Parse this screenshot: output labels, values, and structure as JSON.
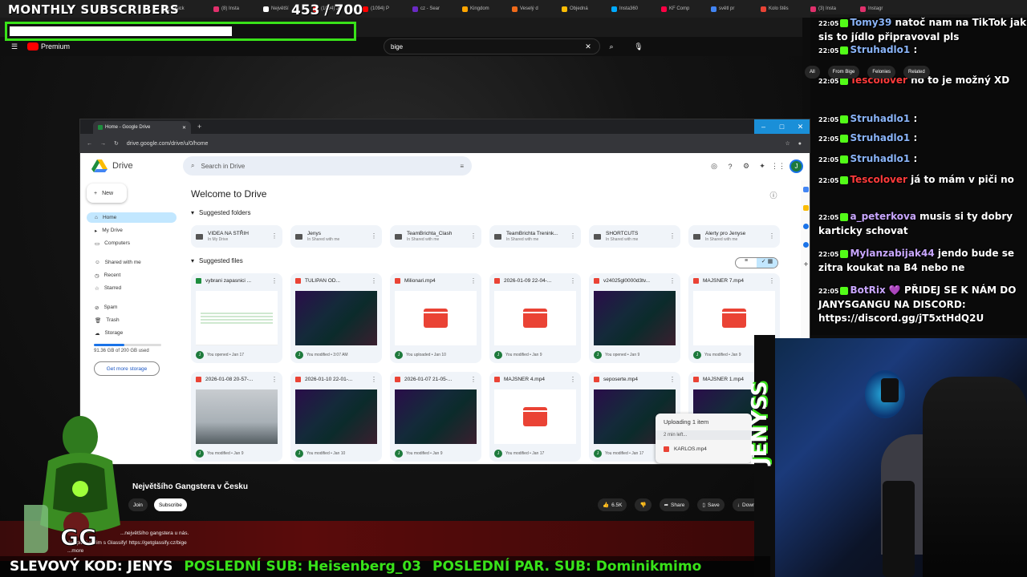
{
  "overlay": {
    "subs_title": "MONTHLY SUBSCRIBERS",
    "subs_count": "453 / 700",
    "subs_progress": 0.65,
    "ticker": {
      "code": "SLEVOVÝ KOD: JENYS",
      "last_sub": "POSLEDNÍ SUB: Heisenberg_03",
      "last_paid_sub": "POSLEDNÍ PAR. SUB: Dominikmimo"
    },
    "streamer_logo": "JENYSS",
    "accent_color": "#39e219"
  },
  "browser": {
    "tabs": [
      "Iddick",
      "(8) Insta",
      "Největší",
      "(1094) Ju",
      "(1094) P",
      "cz - Sear",
      "Kingdom",
      "Veselý d",
      "Objedná",
      "Insta360",
      "KF Comp",
      "světl pr",
      "Kolo štěs",
      "(3) Insta",
      "Instagr"
    ]
  },
  "youtube": {
    "logo": "Premium",
    "search_value": "bige",
    "video_title": "Největšího Gangstera v Česku",
    "subscribe_label": "Subscribe",
    "join_label": "Join",
    "likes": "6.5K",
    "share_label": "Share",
    "save_label": "Save",
    "download_label": "Download",
    "desc_line1": "...největšího gangstera u nás.",
    "desc_line2": "...kuj pitný režim s Glassify! https://getglassify.cz/bige",
    "desc_more": "...more"
  },
  "drive": {
    "tab_title": "Home - Google Drive",
    "url": "drive.google.com/drive/u/0/home",
    "app_name": "Drive",
    "search_placeholder": "Search in Drive",
    "new_label": "New",
    "nav": [
      "Home",
      "My Drive",
      "Computers",
      "Shared with me",
      "Recent",
      "Starred",
      "Spam",
      "Trash",
      "Storage"
    ],
    "storage_used": "91.36 GB of 200 GB used",
    "storage_fraction": 0.457,
    "get_storage": "Get more storage",
    "welcome": "Welcome to Drive",
    "suggested_folders_label": "Suggested folders",
    "suggested_files_label": "Suggested files",
    "folders": [
      {
        "name": "VIDEA NA STŘIH",
        "loc": "In My Drive"
      },
      {
        "name": "Jenys",
        "loc": "In Shared with me"
      },
      {
        "name": "TeamBrichta_Clash",
        "loc": "In Shared with me"
      },
      {
        "name": "TeamBrichta Trenink...",
        "loc": "In Shared with me"
      },
      {
        "name": "SHORTCUTS",
        "loc": "In Shared with me"
      },
      {
        "name": "Alerty pro Jenyse",
        "loc": "In Shared with me"
      }
    ],
    "files_row1": [
      {
        "name": "vybrani zapasnici ...",
        "meta": "You opened • Jan 17",
        "kind": "sheet"
      },
      {
        "name": "TULIPAN OD...",
        "meta": "You modified • 3:07 AM",
        "kind": "video-thumb"
      },
      {
        "name": "Milionari.mp4",
        "meta": "You uploaded • Jan 10",
        "kind": "video"
      },
      {
        "name": "2026-01-09 22-04-...",
        "meta": "You modified • Jan 9",
        "kind": "video"
      },
      {
        "name": "v24025gl0000d3tv...",
        "meta": "You opened • Jan 9",
        "kind": "video-thumb"
      },
      {
        "name": "MAJSNER 7.mp4",
        "meta": "You modified • Jan 9",
        "kind": "video"
      }
    ],
    "files_row2": [
      {
        "name": "2026-01-08 20-57-...",
        "meta": "You modified • Jan 9",
        "kind": "bright-thumb"
      },
      {
        "name": "2026-01-10 22-01-...",
        "meta": "You modified • Jan 10",
        "kind": "video-thumb"
      },
      {
        "name": "2026-01-07 21-05-...",
        "meta": "You modified • Jan 9",
        "kind": "video-thumb"
      },
      {
        "name": "MAJSNER 4.mp4",
        "meta": "You modified • Jan 17",
        "kind": "video"
      },
      {
        "name": "seposerte.mp4",
        "meta": "You modified • Jan 17",
        "kind": "video-thumb"
      },
      {
        "name": "MAJSNER 1.mp4",
        "meta": "",
        "kind": "video-thumb"
      }
    ],
    "upload": {
      "title": "Uploading 1 item",
      "eta": "2 min left...",
      "file": "KARLOS.mp4"
    },
    "avatar_letter": "J"
  },
  "chat": [
    {
      "time": "22:05",
      "user": "Tomy39",
      "color": "#8ab4f8",
      "text": "natoč nam na TikTok jak sis to jídlo připravoval pls"
    },
    {
      "time": "22:05",
      "user": "Struhadlo1",
      "color": "#8ab4f8",
      "text": ":"
    },
    {
      "time": "22:05",
      "user": "Tescolover",
      "color": "#ff3b3b",
      "text": "no to je možný XD"
    },
    {
      "time": "22:05",
      "user": "Struhadlo1",
      "color": "#8ab4f8",
      "text": ":"
    },
    {
      "time": "22:05",
      "user": "Struhadlo1",
      "color": "#8ab4f8",
      "text": ":"
    },
    {
      "time": "22:05",
      "user": "Struhadlo1",
      "color": "#8ab4f8",
      "text": ":"
    },
    {
      "time": "22:05",
      "user": "Tescolover",
      "color": "#ff3b3b",
      "text": "já to mám v piči no"
    },
    {
      "time": "22:05",
      "user": "a_peterkova",
      "color": "#c9a7ff",
      "text": "musis si ty dobry karticky schovat"
    },
    {
      "time": "22:05",
      "user": "Mylanzabijak44",
      "color": "#c9a7ff",
      "text": "jendo bude se zitra koukat na B4 nebo ne"
    },
    {
      "time": "22:05",
      "user": "BotRix",
      "color": "#c9a7ff",
      "text": "💜 PŘIDEJ SE K NÁM DO JANYSGANGU NA DISCORD: https://discord.gg/jT5xtHdQ2U"
    }
  ]
}
